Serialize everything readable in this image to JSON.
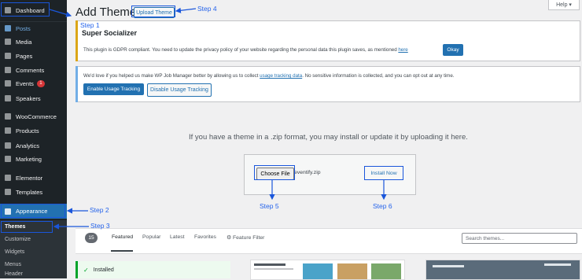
{
  "sidebar": {
    "items": [
      {
        "label": "Dashboard",
        "icon": "dashboard-icon"
      },
      {
        "label": "Posts",
        "icon": "pin-icon"
      },
      {
        "label": "Media",
        "icon": "media-icon"
      },
      {
        "label": "Pages",
        "icon": "pages-icon"
      },
      {
        "label": "Comments",
        "icon": "comment-icon"
      },
      {
        "label": "Events",
        "icon": "calendar-icon",
        "badge": "1"
      },
      {
        "label": "Speakers",
        "icon": "microphone-icon"
      },
      {
        "label": "WooCommerce",
        "icon": "woocommerce-icon"
      },
      {
        "label": "Products",
        "icon": "products-icon"
      },
      {
        "label": "Analytics",
        "icon": "chart-icon"
      },
      {
        "label": "Marketing",
        "icon": "megaphone-icon"
      },
      {
        "label": "Elementor",
        "icon": "elementor-icon"
      },
      {
        "label": "Templates",
        "icon": "folder-icon"
      },
      {
        "label": "Appearance",
        "icon": "brush-icon"
      }
    ],
    "submenu": [
      "Themes",
      "Customize",
      "Widgets",
      "Menus",
      "Header"
    ]
  },
  "header": {
    "title": "Add Themes",
    "upload_button": "Upload Theme",
    "help": "Help ▾"
  },
  "notice1": {
    "heading": "Super Socializer",
    "text_before": "This plugin is GDPR compliant. You need to update the privacy policy of your website regarding the personal data this plugin saves, as mentioned ",
    "link": "here",
    "button": "Okay"
  },
  "notice2": {
    "text_before": "We'd love if you helped us make WP Job Manager better by allowing us to collect ",
    "link": "usage tracking data",
    "text_after": ". No sensitive information is collected, and you can opt out at any time.",
    "enable": "Enable Usage Tracking",
    "disable": "Disable Usage Tracking"
  },
  "upload": {
    "instruction": "If you have a theme in a .zip format, you may install or update it by uploading it here.",
    "choose": "Choose File",
    "filename": "eventify.zip",
    "install": "Install Now"
  },
  "filter": {
    "count": "15",
    "tabs": [
      "Featured",
      "Popular",
      "Latest",
      "Favorites"
    ],
    "feature_filter": "Feature Filter",
    "search_placeholder": "Search themes..."
  },
  "installed": "Installed",
  "steps": [
    "Step 1",
    "Step 2",
    "Step 3",
    "Step 4",
    "Step 5",
    "Step 6"
  ],
  "colors": {
    "accent": "#2271b1",
    "annotation": "#2563eb",
    "sidebar": "#1d2327"
  }
}
